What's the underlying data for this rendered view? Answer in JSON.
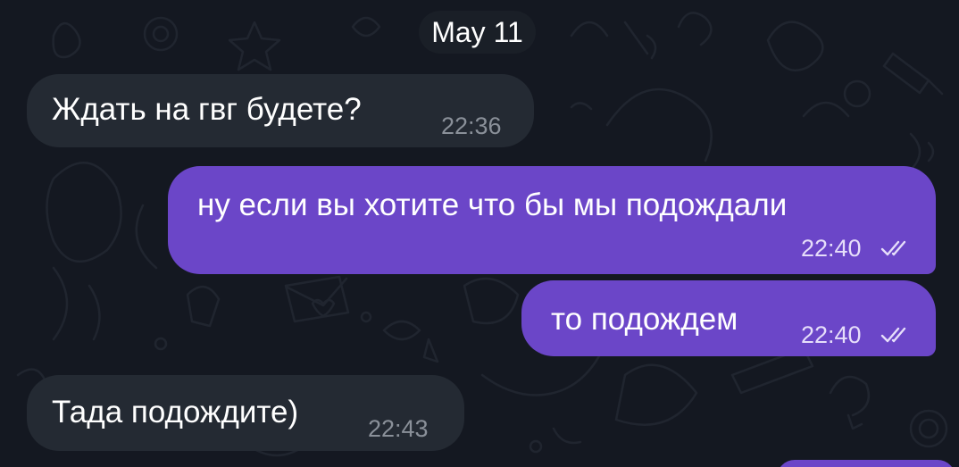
{
  "date_separator": "May 11",
  "messages": [
    {
      "direction": "incoming",
      "text": "Ждать на гвг будете?",
      "time": "22:36"
    },
    {
      "direction": "outgoing",
      "text": "ну если вы хотите что бы мы подождали",
      "time": "22:40",
      "status": "read"
    },
    {
      "direction": "outgoing",
      "text": "то подождем",
      "time": "22:40",
      "status": "read"
    },
    {
      "direction": "incoming",
      "text": "Тада подождите)",
      "time": "22:43"
    }
  ],
  "colors": {
    "background": "#141821",
    "incoming_bubble": "#242a33",
    "outgoing_bubble": "#6b46c8",
    "date_pill": "#1a1f27"
  },
  "icons": {
    "read_status": "double-check-icon"
  }
}
